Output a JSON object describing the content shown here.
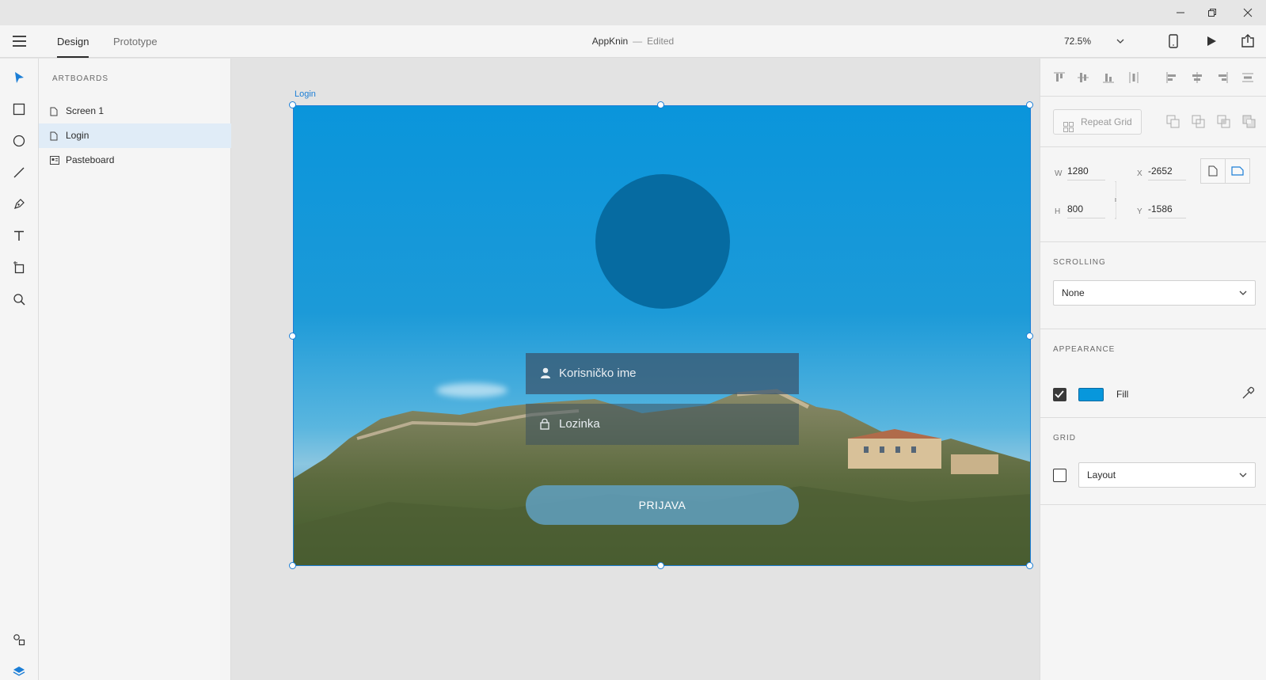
{
  "window": {
    "controls": {
      "minimize": "─",
      "restore": "❐",
      "close": "✕"
    }
  },
  "header": {
    "tabs": [
      {
        "label": "Design",
        "active": true
      },
      {
        "label": "Prototype",
        "active": false
      }
    ],
    "doc_name": "AppKnin",
    "separator": "—",
    "status": "Edited",
    "zoom": "72.5%",
    "icons": [
      "hamburger-menu-icon",
      "device-preview-icon",
      "play-icon",
      "share-icon"
    ]
  },
  "toolbar": {
    "tools": [
      "select-tool-icon",
      "rectangle-tool-icon",
      "ellipse-tool-icon",
      "line-tool-icon",
      "pen-tool-icon",
      "text-tool-icon",
      "artboard-tool-icon",
      "zoom-tool-icon"
    ],
    "bottom": [
      "assets-icon",
      "layers-icon"
    ]
  },
  "layers": {
    "title": "ARTBOARDS",
    "items": [
      {
        "label": "Screen 1",
        "icon": "artboard-page-icon",
        "selected": false
      },
      {
        "label": "Login",
        "icon": "artboard-page-icon",
        "selected": true
      },
      {
        "label": "Pasteboard",
        "icon": "pasteboard-icon",
        "selected": false
      }
    ]
  },
  "canvas": {
    "artboard_label": "Login",
    "username_placeholder": "Korisničko ime",
    "password_placeholder": "Lozinka",
    "login_button": "PRIJAVA"
  },
  "inspector": {
    "repeat_grid": "Repeat Grid",
    "w_label": "W",
    "w_value": "1280",
    "h_label": "H",
    "h_value": "800",
    "x_label": "X",
    "x_value": "-2652",
    "y_label": "Y",
    "y_value": "-1586",
    "scrolling_title": "SCROLLING",
    "scrolling_value": "None",
    "appearance_title": "APPEARANCE",
    "fill_label": "Fill",
    "fill_checked": true,
    "fill_color": "#0797dc",
    "grid_title": "GRID",
    "grid_value": "Layout",
    "grid_checked": false
  }
}
